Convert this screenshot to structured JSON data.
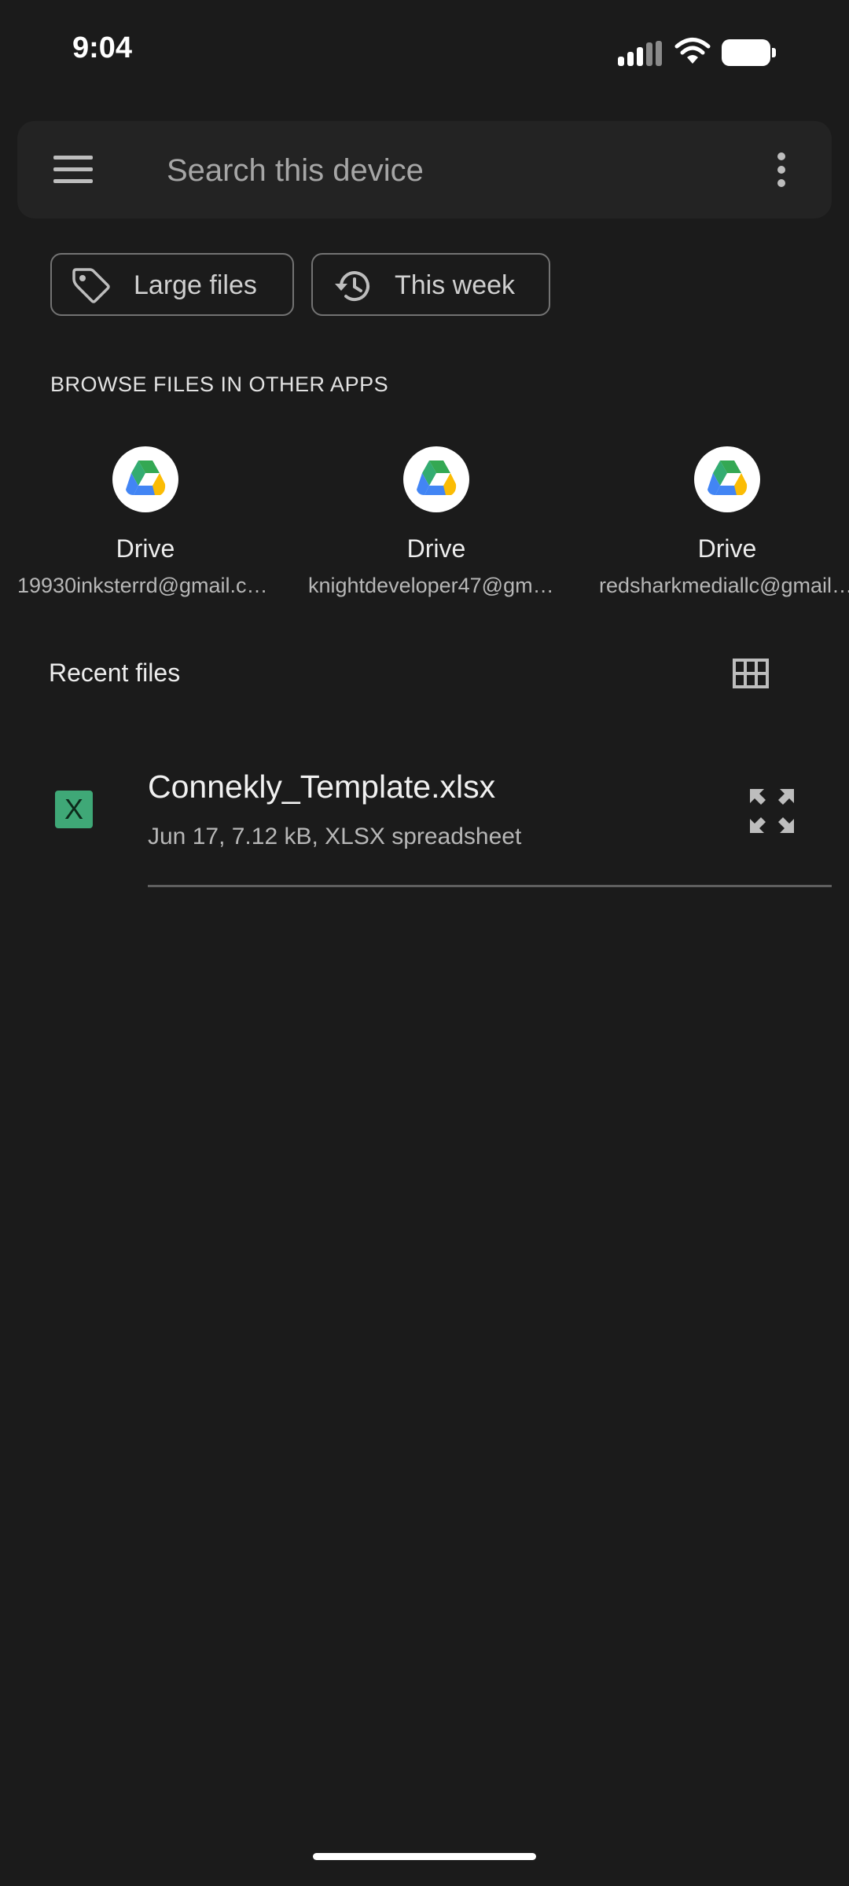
{
  "status_bar": {
    "time": "9:04"
  },
  "search": {
    "placeholder": "Search this device"
  },
  "chips": [
    {
      "label": "Large files",
      "icon": "tag-icon"
    },
    {
      "label": "This week",
      "icon": "history-icon"
    }
  ],
  "browse": {
    "title": "BROWSE FILES IN OTHER APPS",
    "apps": [
      {
        "name": "Drive",
        "account": "19930inksterrd@gmail.com"
      },
      {
        "name": "Drive",
        "account": "knightdeveloper47@gmail.com"
      },
      {
        "name": "Drive",
        "account": "redsharkmediallc@gmail.com"
      }
    ]
  },
  "recent": {
    "title": "Recent files",
    "files": [
      {
        "name": "Connekly_Template.xlsx",
        "meta": "Jun 17, 7.12 kB, XLSX spreadsheet",
        "icon_letter": "X"
      }
    ]
  },
  "colors": {
    "background": "#1b1b1b",
    "search_bar": "#232323",
    "xlsx_green": "#3fa877"
  }
}
